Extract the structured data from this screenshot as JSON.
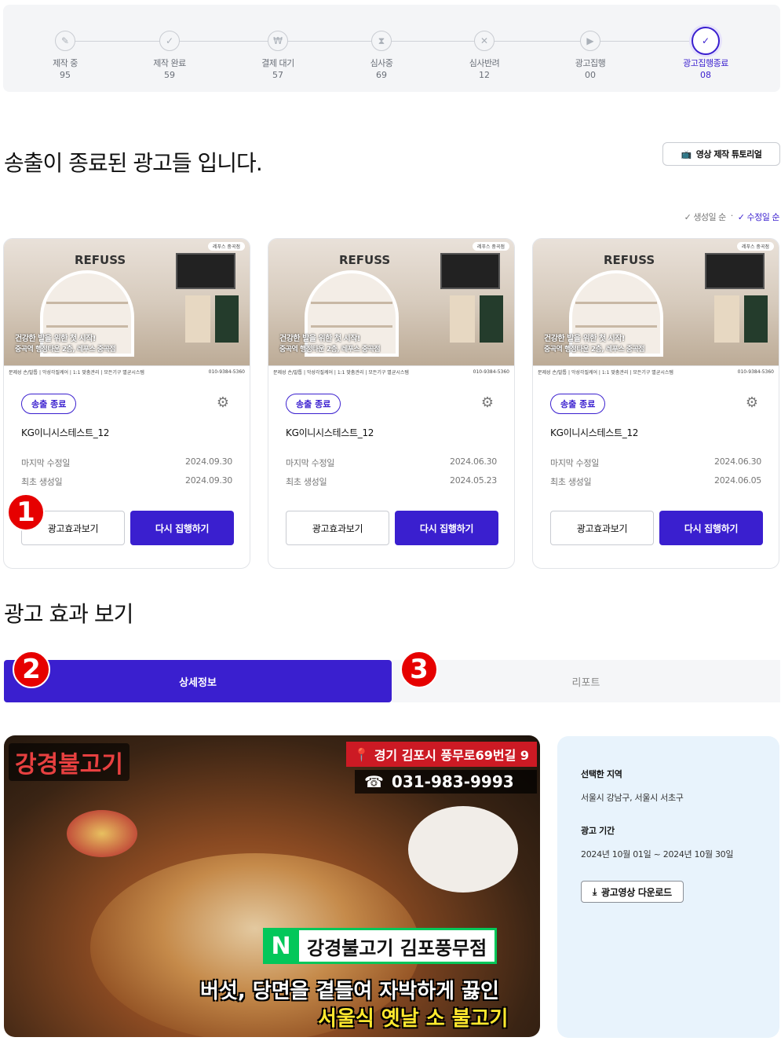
{
  "stepper": {
    "steps": [
      {
        "label": "제작 중",
        "count": "95",
        "icon": "document-edit-icon"
      },
      {
        "label": "제작 완료",
        "count": "59",
        "icon": "document-check-icon"
      },
      {
        "label": "결제 대기",
        "count": "57",
        "icon": "won-icon"
      },
      {
        "label": "심사중",
        "count": "69",
        "icon": "hourglass-icon"
      },
      {
        "label": "심사반려",
        "count": "12",
        "icon": "x-circle-icon"
      },
      {
        "label": "광고집행",
        "count": "00",
        "icon": "play-icon"
      },
      {
        "label": "광고집행종료",
        "count": "08",
        "icon": "check-circle-icon",
        "active": true
      }
    ]
  },
  "page": {
    "title": "송출이 종료된 광고들 입니다.",
    "tutorial_label": "영상 제작 튜토리얼",
    "sort": {
      "created": "생성일 순",
      "modified": "수정일 순",
      "active": "modified"
    }
  },
  "cards": [
    {
      "status": "송출 종료",
      "name": "KG이니시스테스트_12",
      "modified_label": "마지막 수정일",
      "modified": "2024.09.30",
      "created_label": "최초 생성일",
      "created": "2024.09.30",
      "btn_effect": "광고효과보기",
      "btn_rerun": "다시 집행하기",
      "thumb": {
        "brand": "REFUSS",
        "caption1": "건강한 발을 위한 첫 시작!",
        "caption2": "중곡역 행정타운 2층, 레푸스 중곡점",
        "strip": "문제성 손/발톱 | 악성각질케어 | 1:1 맞춤관리 | 모든기구 멸균시스템",
        "phone": "010-9384-5360",
        "naver": "레푸스 중곡점"
      }
    },
    {
      "status": "송출 종료",
      "name": "KG이니시스테스트_12",
      "modified_label": "마지막 수정일",
      "modified": "2024.06.30",
      "created_label": "최초 생성일",
      "created": "2024.05.23",
      "btn_effect": "광고효과보기",
      "btn_rerun": "다시 집행하기",
      "thumb": {
        "brand": "REFUSS",
        "caption1": "건강한 발을 위한 첫 시작!",
        "caption2": "중곡역 행정타운 2층, 레푸스 중곡점",
        "strip": "문제성 손/발톱 | 악성각질케어 | 1:1 맞춤관리 | 모든기구 멸균시스템",
        "phone": "010-9384-5360",
        "naver": "레푸스 중곡점"
      }
    },
    {
      "status": "송출 종료",
      "name": "KG이니시스테스트_12",
      "modified_label": "마지막 수정일",
      "modified": "2024.06.30",
      "created_label": "최초 생성일",
      "created": "2024.06.05",
      "btn_effect": "광고효과보기",
      "btn_rerun": "다시 집행하기",
      "thumb": {
        "brand": "REFUSS",
        "caption1": "건강한 발을 위한 첫 시작!",
        "caption2": "중곡역 행정타운 2층, 레푸스 중곡점",
        "strip": "문제성 손/발톱 | 악성각질케어 | 1:1 맞춤관리 | 모든기구 멸균시스템",
        "phone": "010-9384-5360",
        "naver": "레푸스 중곡점"
      }
    }
  ],
  "markers": [
    "1",
    "2",
    "3"
  ],
  "effect": {
    "title": "광고 효과 보기",
    "tabs": [
      {
        "label": "상세정보",
        "active": true
      },
      {
        "label": "리포트",
        "active": false
      }
    ],
    "video": {
      "shop_name": "강경불고기",
      "address": "경기 김포시 풍무로69번길 9",
      "phone": "031-983-9993",
      "naver_label": "강경불고기 김포풍무점",
      "caption1": "버섯, 당면을 곁들여 자박하게 끓인",
      "caption2": "서울식 옛날 소 불고기"
    },
    "info": {
      "region_label": "선택한 지역",
      "region_value": "서울시 강남구, 서울시 서초구",
      "period_label": "광고 기간",
      "period_value": "2024년 10월 01일 ~ 2024년 10월 30일",
      "download_label": "광고영상 다운로드"
    }
  },
  "colors": {
    "accent": "#3a1fcf",
    "marker": "#e60000",
    "info_bg": "#e8f3fc"
  }
}
